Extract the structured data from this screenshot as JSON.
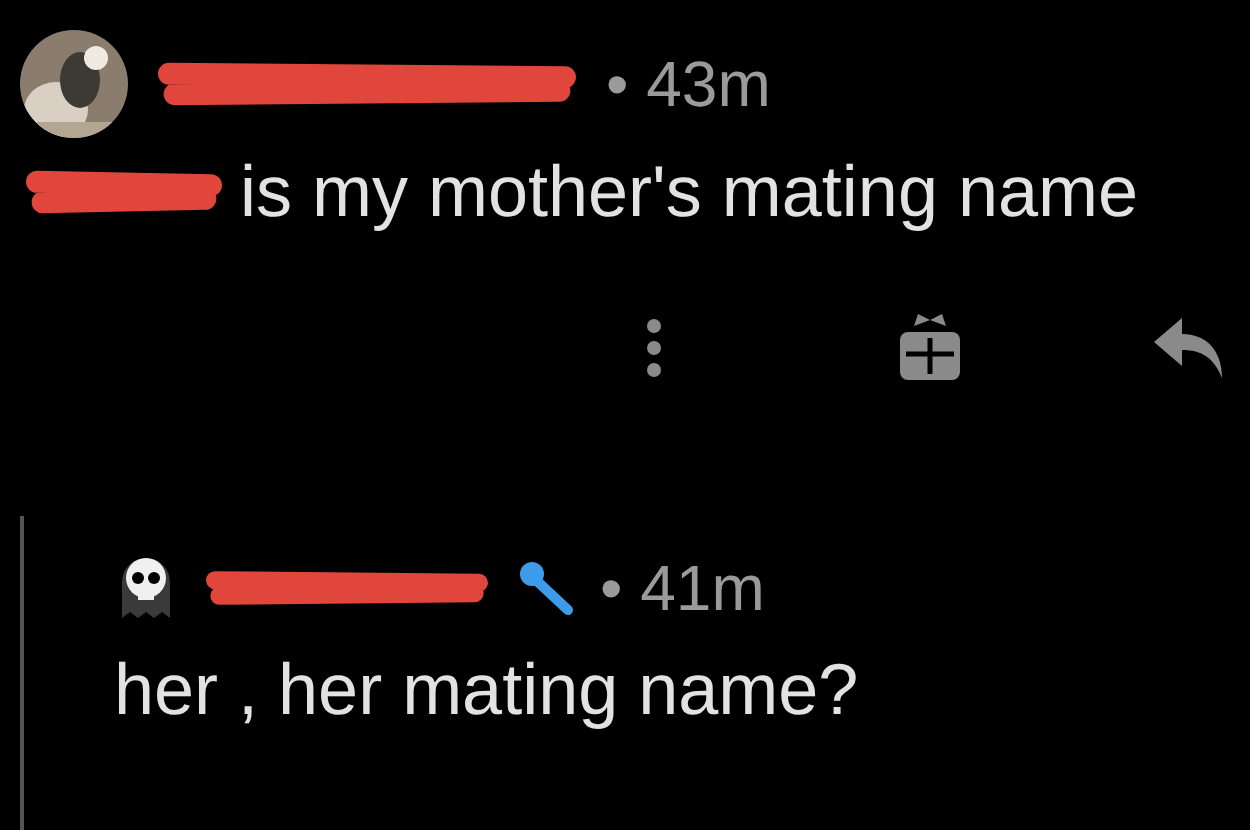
{
  "comments": [
    {
      "kind": "top",
      "time": "• 43m",
      "body": "is my mother's mating name"
    },
    {
      "kind": "reply",
      "time": "• 41m",
      "body": "her , her mating name?"
    }
  ]
}
